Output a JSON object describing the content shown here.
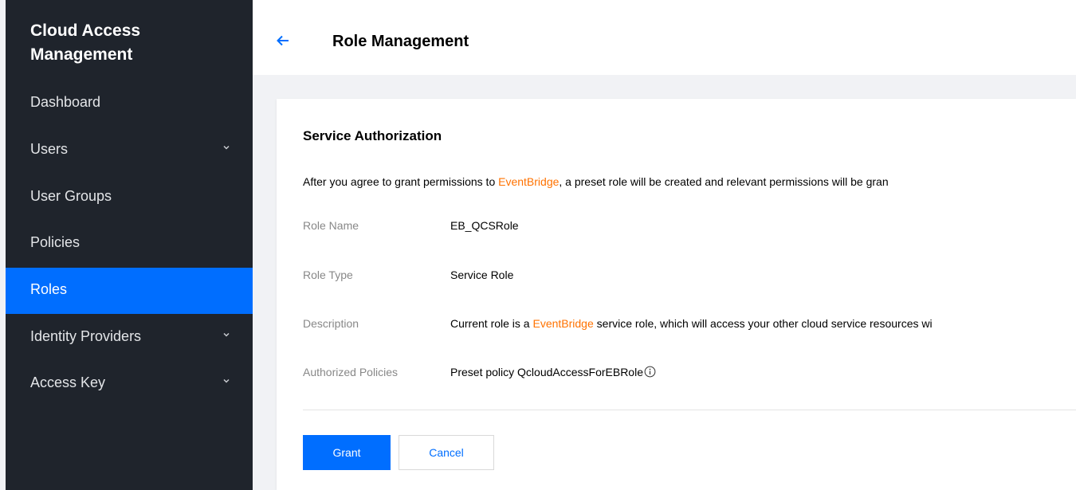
{
  "sidebar": {
    "title": "Cloud Access Management",
    "items": [
      {
        "label": "Dashboard"
      },
      {
        "label": "Users"
      },
      {
        "label": "User Groups"
      },
      {
        "label": "Policies"
      },
      {
        "label": "Roles"
      },
      {
        "label": "Identity Providers"
      },
      {
        "label": "Access Key"
      }
    ],
    "active_item": "Roles"
  },
  "header": {
    "back_icon": "arrow-left-icon",
    "title": "Role Management"
  },
  "card": {
    "section_title": "Service Authorization",
    "intro": {
      "before": "After you agree to grant permissions to ",
      "highlight": "EventBridge",
      "after": ", a preset role will be created and relevant permissions will be gran"
    },
    "fields": {
      "role_name": {
        "label": "Role Name",
        "value": "EB_QCSRole"
      },
      "role_type": {
        "label": "Role Type",
        "value": "Service Role"
      },
      "description": {
        "label": "Description",
        "value_before": "Current role is a ",
        "value_highlight": "EventBridge",
        "value_after": " service role, which will access your other cloud service resources wi"
      },
      "authorized_policies": {
        "label": "Authorized Policies",
        "value": "Preset policy QcloudAccessForEBRole"
      }
    },
    "buttons": {
      "grant": "Grant",
      "cancel": "Cancel"
    }
  },
  "colors": {
    "sidebar_bg": "#1f242c",
    "active": "#006eff",
    "highlight": "#ff7200"
  }
}
